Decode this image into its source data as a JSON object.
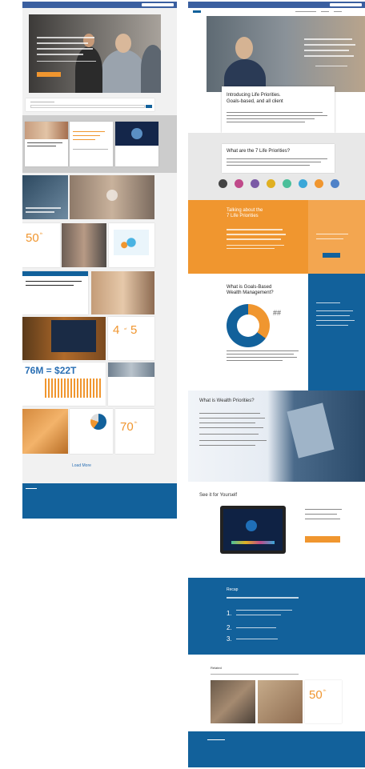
{
  "left_page": {
    "hero": {
      "button_label": ""
    },
    "load_more_label": "Load More",
    "stats": {
      "tile_50": {
        "number": "50",
        "suffix": "th"
      },
      "tile_4of5": {
        "number": "4",
        "of": "of",
        "number2": "5"
      },
      "tile_76m": {
        "text": "76M = $22T"
      },
      "tile_70": {
        "number": "70",
        "suffix": "th"
      }
    }
  },
  "right_page": {
    "intro": {
      "title_line1": "Introducing Life Priorities.",
      "title_line2": "Goals-based, and all client"
    },
    "seven": {
      "title": "What are the 7 Life Priorities?"
    },
    "orange": {
      "title_line1": "Talking about the",
      "title_line2": "7 Life Priorities"
    },
    "donut": {
      "title_line1": "What is Goals-Based",
      "title_line2": "Wealth Management?",
      "value_label": "##",
      "percent": 35
    },
    "wealth": {
      "title": "What is Wealth Priorities?"
    },
    "tools": {
      "title": "See it for Yourself"
    },
    "steps": {
      "title": "Recap",
      "items": [
        "1.",
        "2.",
        "3."
      ]
    },
    "related": {
      "title": "Related",
      "stat_number": "50",
      "stat_suffix": "th"
    }
  },
  "colors": {
    "brand_blue": "#12619b",
    "accent_orange": "#f0962f",
    "topbar": "#3a5fa0"
  }
}
